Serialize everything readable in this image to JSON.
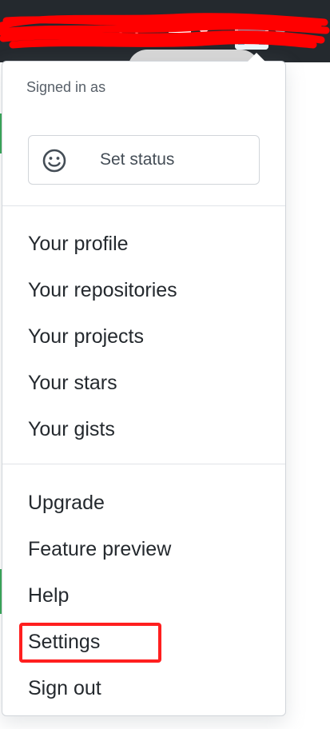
{
  "header": {
    "bell_icon": "bell-icon",
    "plus_icon": "plus-icon",
    "avatar_icon": "avatar-icon"
  },
  "user": {
    "signed_in_label": "Signed in as"
  },
  "status": {
    "label": "Set status",
    "icon": "smiley-icon"
  },
  "menu": {
    "group1": [
      "Your profile",
      "Your repositories",
      "Your projects",
      "Your stars",
      "Your gists"
    ],
    "group2": [
      "Upgrade",
      "Feature preview",
      "Help",
      "Settings",
      "Sign out"
    ]
  },
  "annotations": {
    "highlight_color": "#ff1f1f",
    "redaction_color": "#ff0000"
  }
}
